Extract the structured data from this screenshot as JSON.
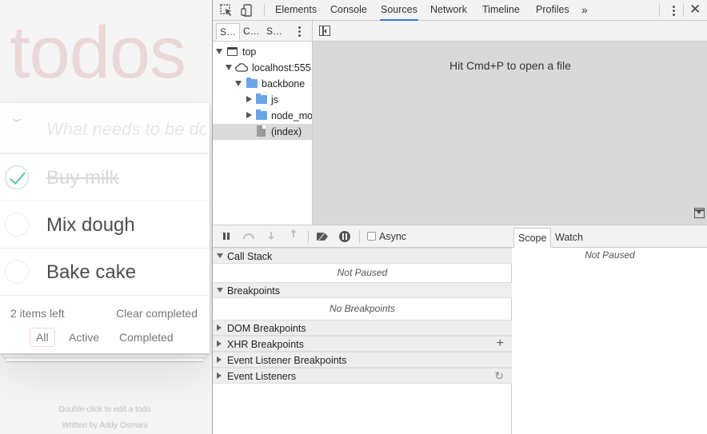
{
  "todo": {
    "title": "todos",
    "new_placeholder": "What needs to be done?",
    "items": [
      {
        "label": "Buy milk",
        "completed": true
      },
      {
        "label": "Mix dough",
        "completed": false
      },
      {
        "label": "Bake cake",
        "completed": false
      }
    ],
    "items_left": "2 items left",
    "clear_completed": "Clear completed",
    "filters": [
      "All",
      "Active",
      "Completed"
    ],
    "selected_filter": "All",
    "info_edit": "Double-click to edit a todo",
    "info_written_prefix": "Written by ",
    "info_author": "Addy Osmani"
  },
  "devtools": {
    "tabs": [
      "Elements",
      "Console",
      "Sources",
      "Network",
      "Timeline",
      "Profiles"
    ],
    "active_tab": "Sources",
    "more_tabs": "»",
    "close": "✕",
    "navigator": {
      "tabs": [
        "S…",
        "C…",
        "S…"
      ],
      "tree": {
        "top": "top",
        "host": "localhost:555",
        "folder": "backbone",
        "js": "js",
        "node_modules": "node_mo",
        "index": "(index)"
      }
    },
    "editor_hint": "Hit Cmd+P to open a file",
    "debugger": {
      "async_label": "Async",
      "call_stack": "Call Stack",
      "not_paused": "Not Paused",
      "breakpoints": "Breakpoints",
      "no_breakpoints": "No Breakpoints",
      "dom_breakpoints": "DOM Breakpoints",
      "xhr_breakpoints": "XHR Breakpoints",
      "event_listener_breakpoints": "Event Listener Breakpoints",
      "event_listeners": "Event Listeners",
      "plus": "+",
      "refresh": "↻"
    },
    "scope": {
      "tabs": [
        "Scope",
        "Watch"
      ],
      "not_paused": "Not Paused"
    }
  }
}
